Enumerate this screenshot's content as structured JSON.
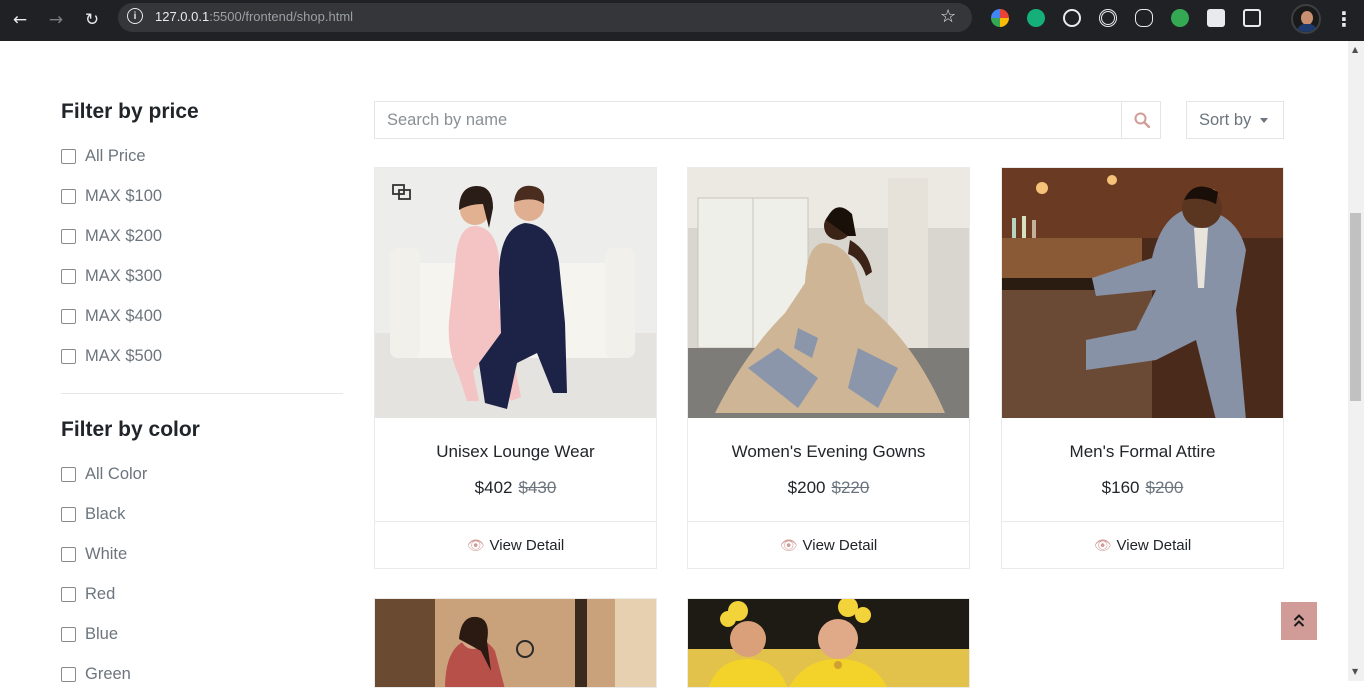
{
  "browser": {
    "url_host": "127.0.0.1",
    "url_rest": ":5500/frontend/shop.html",
    "back_icon": "←",
    "forward_icon": "→",
    "reload_icon": "↻",
    "star_icon": "☆",
    "menu_icon": "⋮"
  },
  "sidebar": {
    "price_title": "Filter by price",
    "price_options": [
      "All Price",
      "MAX $100",
      "MAX $200",
      "MAX $300",
      "MAX $400",
      "MAX $500"
    ],
    "color_title": "Filter by color",
    "color_options": [
      "All Color",
      "Black",
      "White",
      "Red",
      "Blue",
      "Green"
    ]
  },
  "toolbar": {
    "search_placeholder": "Search by name",
    "sort_label": "Sort by"
  },
  "products": [
    {
      "name": "Unisex Lounge Wear",
      "price": "$402",
      "old_price": "$430",
      "action": "View Detail"
    },
    {
      "name": "Women's Evening Gowns",
      "price": "$200",
      "old_price": "$220",
      "action": "View Detail"
    },
    {
      "name": "Men's Formal Attire",
      "price": "$160",
      "old_price": "$200",
      "action": "View Detail"
    }
  ],
  "colors": {
    "accent": "#d19c97",
    "chrome_bg": "#202124"
  }
}
